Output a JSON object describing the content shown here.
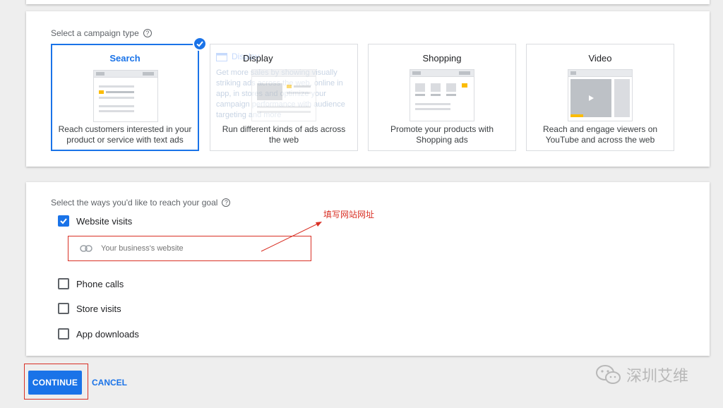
{
  "campaign_type": {
    "label": "Select a campaign type",
    "help": "?",
    "tiles": [
      {
        "title": "Search",
        "desc": "Reach customers interested in your product or service with text ads",
        "selected": true
      },
      {
        "title": "Display",
        "desc": "Run different kinds of ads across the web",
        "selected": false,
        "ghost_title": "Display",
        "ghost_text": "Get more sales by showing visually striking ads across the web, online in app, in stores and optimize your campaign performance with audience targeting and more"
      },
      {
        "title": "Shopping",
        "desc": "Promote your products with Shopping ads",
        "selected": false
      },
      {
        "title": "Video",
        "desc": "Reach and engage viewers on YouTube and across the web",
        "selected": false
      }
    ]
  },
  "goal": {
    "label": "Select the ways you'd like to reach your goal",
    "help": "?",
    "options": [
      {
        "label": "Website visits",
        "checked": true
      },
      {
        "label": "Phone calls",
        "checked": false
      },
      {
        "label": "Store visits",
        "checked": false
      },
      {
        "label": "App downloads",
        "checked": false
      }
    ],
    "website_placeholder": "Your business's website"
  },
  "annotation": {
    "text": "填写网站网址"
  },
  "actions": {
    "continue": "CONTINUE",
    "cancel": "CANCEL"
  },
  "watermark": {
    "text": "深圳艾维"
  },
  "colors": {
    "accent": "#1a73e8",
    "annotation": "#d93025",
    "ad_highlight": "#fbbc04"
  }
}
